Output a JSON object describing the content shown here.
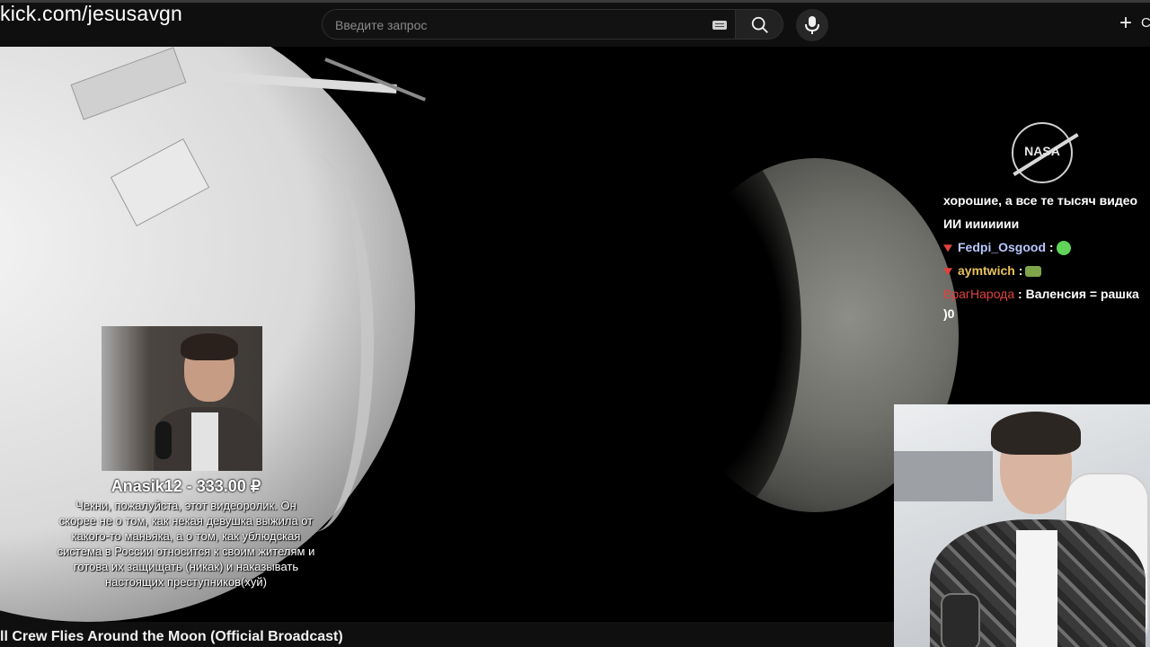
{
  "overlay": {
    "stream_url": "kick.com/jesusavgn"
  },
  "search": {
    "placeholder": "Введите запрос",
    "keyboard_icon": "keyboard-icon",
    "search_icon": "search-icon",
    "mic_icon": "microphone-icon"
  },
  "header": {
    "create_icon": "plus-icon",
    "create_label": "C"
  },
  "video": {
    "title": "ll Crew Flies Around the Moon (Official Broadcast)",
    "logo_text": "NASA"
  },
  "donation": {
    "title": "Anasik12 - 333.00 ₽",
    "message": "Чекни, пожалуйста, этот видеоролик. Он скорее не о том, как некая девушка выжила от какого-то маньяка, а о том, как ублюдская система в России относится к своим жителям и готова их защищать (никак) и наказывать настоящих преступников(хуй)"
  },
  "chat": {
    "cut_text": "хорошие, а все те тысяч видео",
    "messages": [
      {
        "text": "ИИ иииииии"
      },
      {
        "user": "Fedpi_Osgood",
        "user_color": "#b7c8ff",
        "badge_color": "#e0433c",
        "text": "",
        "emote": "green-emote-icon"
      },
      {
        "user": "aymtwich",
        "user_color": "#e8c25a",
        "badge_color": "#e0433c",
        "text": "",
        "emote": "car-emote-icon"
      },
      {
        "user": "ВрагНарода",
        "user_color": "#e0433c",
        "text": "Валенсия = рашка"
      },
      {
        "text": ")0"
      }
    ]
  },
  "colors": {
    "page_bg": "#0f0f0f",
    "video_bg": "#000000",
    "text": "#f1f1f1"
  }
}
